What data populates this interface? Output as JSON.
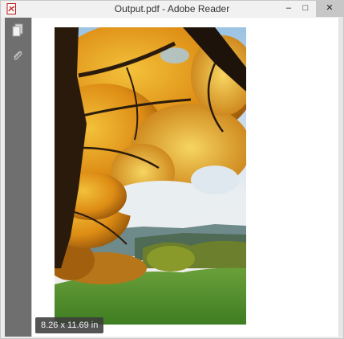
{
  "window": {
    "title": "Output.pdf - Adobe Reader",
    "controls": {
      "minimize": "–",
      "maximize": "□",
      "close": "✕"
    }
  },
  "sidebar": {
    "tools": [
      {
        "icon": "pages-icon"
      },
      {
        "icon": "paperclip-icon"
      }
    ]
  },
  "document": {
    "page_size_label": "8.26 x 11.69 in"
  },
  "colors": {
    "sidebar_bg": "#6f6f6f",
    "sky": "#e6eef3",
    "foliage": "#d98a12",
    "grass": "#4e8f2e"
  }
}
